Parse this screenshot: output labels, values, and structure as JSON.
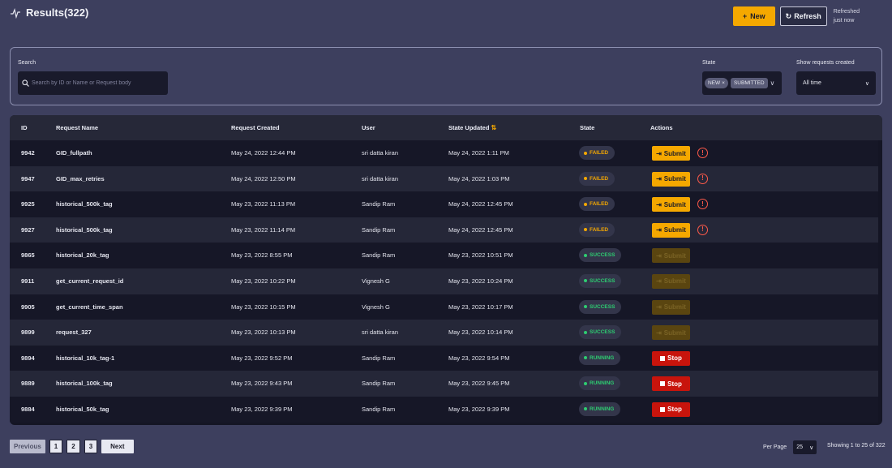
{
  "header": {
    "title": "Results(322)",
    "new_label": "New",
    "refresh_label": "Refresh",
    "refreshed_line1": "Refreshed",
    "refreshed_line2": "just now"
  },
  "filters": {
    "search_label": "Search",
    "search_placeholder": "Search by ID or Name or Request body",
    "state_label": "State",
    "state_chips": [
      "NEW",
      "SUBMITTED"
    ],
    "created_label": "Show requests created",
    "created_value": "All time"
  },
  "table": {
    "columns": [
      "ID",
      "Request Name",
      "Request Created",
      "User",
      "State Updated",
      "State",
      "Actions"
    ],
    "rows": [
      {
        "id": "9942",
        "name": "GID_fullpath",
        "created": "May 24, 2022 12:44 PM",
        "user": "sri datta kiran",
        "updated": "May 24, 2022 1:11 PM",
        "state": "FAILED",
        "action": "Submit"
      },
      {
        "id": "9947",
        "name": "GID_max_retries",
        "created": "May 24, 2022 12:50 PM",
        "user": "sri datta kiran",
        "updated": "May 24, 2022 1:03 PM",
        "state": "FAILED",
        "action": "Submit"
      },
      {
        "id": "9925",
        "name": "historical_500k_tag",
        "created": "May 23, 2022 11:13 PM",
        "user": "Sandip Ram",
        "updated": "May 24, 2022 12:45 PM",
        "state": "FAILED",
        "action": "Submit"
      },
      {
        "id": "9927",
        "name": "historical_500k_tag",
        "created": "May 23, 2022 11:14 PM",
        "user": "Sandip Ram",
        "updated": "May 24, 2022 12:45 PM",
        "state": "FAILED",
        "action": "Submit"
      },
      {
        "id": "9865",
        "name": "historical_20k_tag",
        "created": "May 23, 2022 8:55 PM",
        "user": "Sandip Ram",
        "updated": "May 23, 2022 10:51 PM",
        "state": "SUCCESS",
        "action": "Submit"
      },
      {
        "id": "9911",
        "name": "get_current_request_id",
        "created": "May 23, 2022 10:22 PM",
        "user": "Vignesh G",
        "updated": "May 23, 2022 10:24 PM",
        "state": "SUCCESS",
        "action": "Submit"
      },
      {
        "id": "9905",
        "name": "get_current_time_span",
        "created": "May 23, 2022 10:15 PM",
        "user": "Vignesh G",
        "updated": "May 23, 2022 10:17 PM",
        "state": "SUCCESS",
        "action": "Submit"
      },
      {
        "id": "9899",
        "name": "request_327",
        "created": "May 23, 2022 10:13 PM",
        "user": "sri datta kiran",
        "updated": "May 23, 2022 10:14 PM",
        "state": "SUCCESS",
        "action": "Submit"
      },
      {
        "id": "9894",
        "name": "historical_10k_tag-1",
        "created": "May 23, 2022 9:52 PM",
        "user": "Sandip Ram",
        "updated": "May 23, 2022 9:54 PM",
        "state": "RUNNING",
        "action": "Stop"
      },
      {
        "id": "9889",
        "name": "historical_100k_tag",
        "created": "May 23, 2022 9:43 PM",
        "user": "Sandip Ram",
        "updated": "May 23, 2022 9:45 PM",
        "state": "RUNNING",
        "action": "Stop"
      },
      {
        "id": "9884",
        "name": "historical_50k_tag",
        "created": "May 23, 2022 9:39 PM",
        "user": "Sandip Ram",
        "updated": "May 23, 2022 9:39 PM",
        "state": "RUNNING",
        "action": "Stop"
      }
    ]
  },
  "state_colors": {
    "FAILED": "#f5a800",
    "SUCCESS": "#2ecc71",
    "RUNNING": "#2ecc71"
  },
  "pagination": {
    "previous": "Previous",
    "pages": [
      "1",
      "2",
      "3"
    ],
    "next": "Next",
    "per_page_label": "Per Page",
    "per_page_value": "25",
    "showing": "Showing 1 to 25 of 322"
  }
}
